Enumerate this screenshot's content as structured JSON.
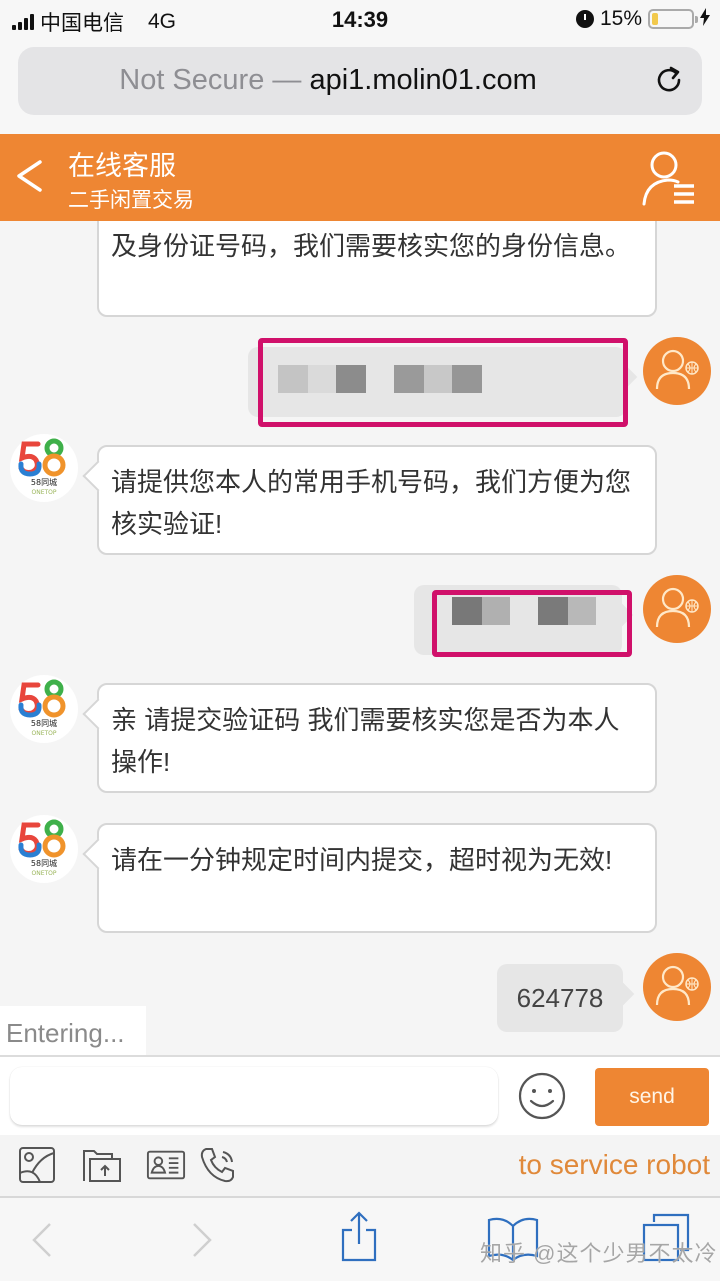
{
  "status_bar": {
    "carrier": "中国电信",
    "network": "4G",
    "time": "14:39",
    "battery_percent_label": "15%",
    "battery_level": 0.15,
    "charging": true
  },
  "browser": {
    "security_label": "Not Secure —",
    "domain": "api1.molin01.com",
    "reload_icon": "reload-icon"
  },
  "header": {
    "title": "在线客服",
    "subtitle": "二手闲置交易",
    "back_icon": "chevron-left-icon",
    "menu_icon": "user-list-icon"
  },
  "colors": {
    "brand_orange": "#ee8633",
    "redaction_border": "#d0106a",
    "robot_link": "#e0893a"
  },
  "messages": [
    {
      "sender": "agent",
      "avatar": "58同城 ONETOP",
      "text": "及身份证号码，我们需要核实您的身份信息。",
      "partial": true
    },
    {
      "sender": "user",
      "redacted": true,
      "text": ""
    },
    {
      "sender": "agent",
      "avatar": "58同城 ONETOP",
      "text": "请提供您本人的常用手机号码，我们方便为您核实验证!"
    },
    {
      "sender": "user",
      "redacted": true,
      "text": ""
    },
    {
      "sender": "agent",
      "avatar": "58同城 ONETOP",
      "text": "亲 请提交验证码  我们需要核实您是否为本人操作!"
    },
    {
      "sender": "agent",
      "avatar": "58同城 ONETOP",
      "text": "请在一分钟规定时间内提交，超时视为无效!"
    },
    {
      "sender": "user",
      "text": "624778"
    }
  ],
  "avatar58": {
    "digits": "58",
    "brand": "58同城",
    "tagline": "ONETOP"
  },
  "typing_status": "Entering...",
  "composer": {
    "input_value": "",
    "input_placeholder": "",
    "send_label": "send"
  },
  "toolbar": {
    "tools": [
      "image-icon",
      "folder-upload-icon",
      "contact-card-icon",
      "phone-call-icon"
    ],
    "robot_link": "to service robot"
  },
  "safari_toolbar": {
    "buttons": [
      "back-icon",
      "forward-icon",
      "share-icon",
      "bookmarks-icon",
      "tabs-icon"
    ]
  },
  "watermark": "知乎 @这个少男不太冷"
}
